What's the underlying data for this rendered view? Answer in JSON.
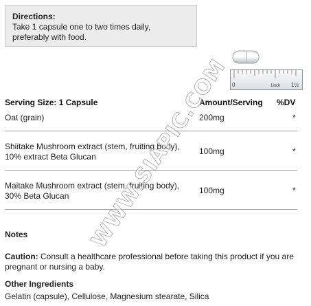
{
  "directions": {
    "heading": "Directions:",
    "line1": "Take 1 capsule one to two times daily,",
    "line2": "preferably with food."
  },
  "ruler": {
    "zero": "0",
    "unit": "1inch",
    "last": "1½"
  },
  "icons": {
    "capsule": "capsule-icon",
    "ruler": "ruler-icon"
  },
  "facts": {
    "serving_size": "Serving Size: 1 Capsule",
    "amount_header": "Amount/Serving",
    "dv_header": "%DV",
    "rows": [
      {
        "name_l1": "Oat (grain)",
        "name_l2": "",
        "amount": "200mg",
        "dv": "*"
      },
      {
        "name_l1": "Shiitake Mushroom extract (stem, fruiting body),",
        "name_l2": "10% extract Beta Glucan",
        "amount": "100mg",
        "dv": "*"
      },
      {
        "name_l1": "Maitake Mushroom extract (stem, fruiting body),",
        "name_l2": "30% Beta Glucan",
        "amount": "100mg",
        "dv": "*"
      }
    ]
  },
  "notes": {
    "heading": "Notes",
    "caution_label": "Caution:",
    "caution_text": " Consult a healthcare professional before taking this product if you are pregnant or nursing a baby."
  },
  "other": {
    "heading": "Other Ingredients",
    "text": "Gelatin (capsule), Cellulose, Magnesium stearate, Silica"
  },
  "watermark": "WWW.SIAPIC.COM",
  "colors": {
    "panel_bg": "#ececec",
    "rule": "#9a9a9a",
    "text": "#222222"
  }
}
